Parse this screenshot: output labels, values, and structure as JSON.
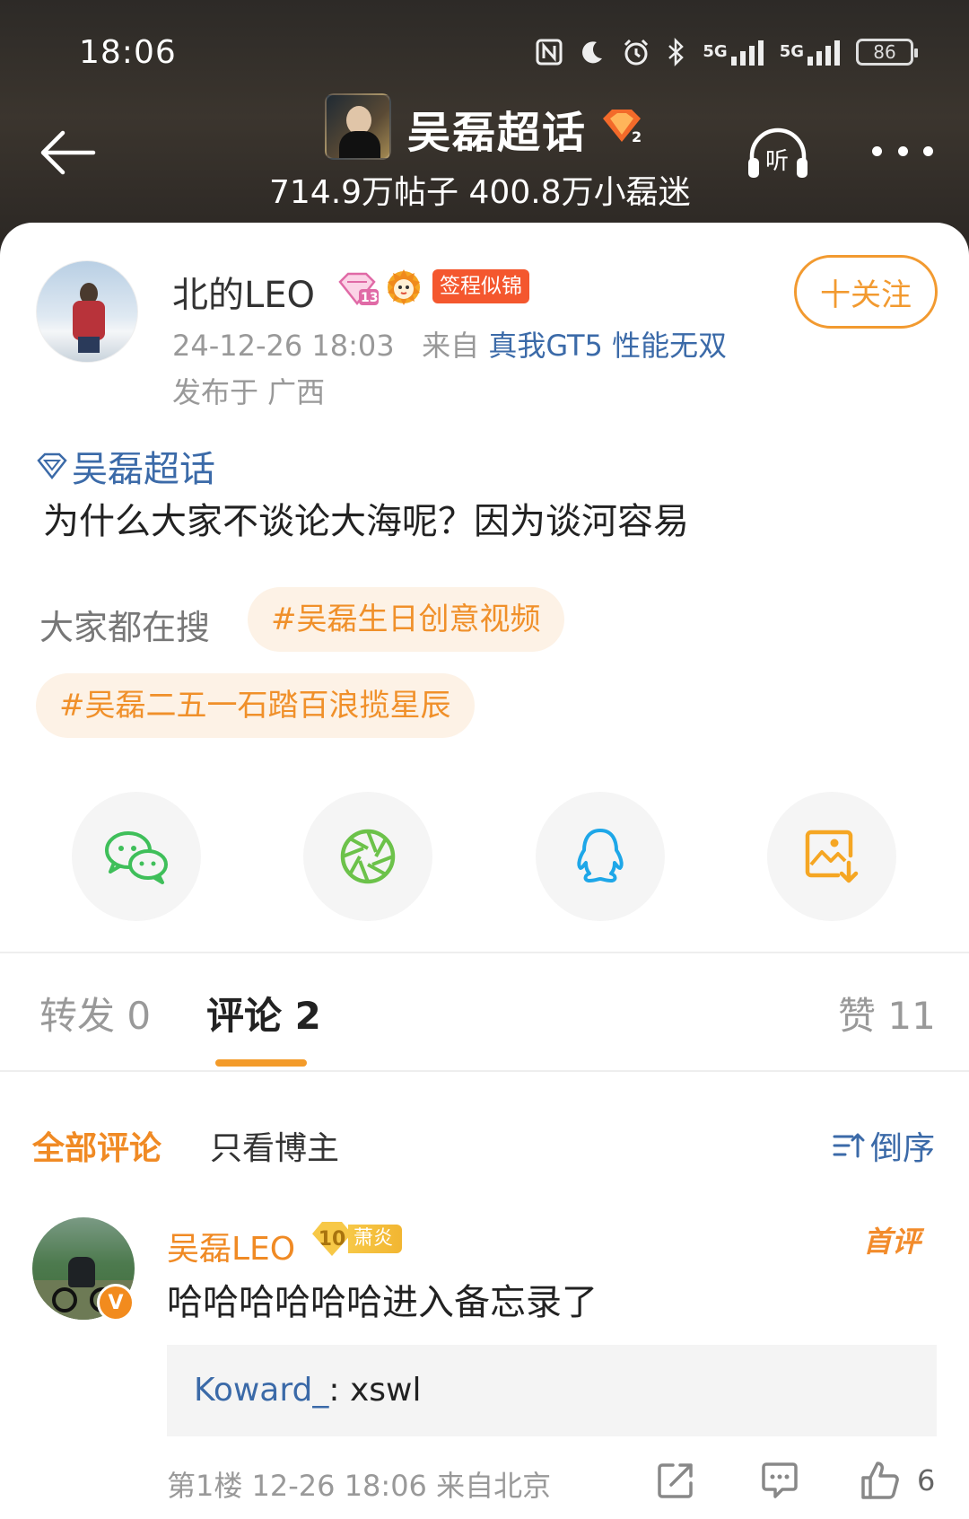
{
  "status": {
    "time": "18:06",
    "net1": "5G",
    "net2": "5G",
    "battery": "86"
  },
  "header": {
    "title": "吴磊超话",
    "title_badge_level": "2",
    "stats": "714.9万帖子 400.8万小磊迷",
    "listen_label": "听"
  },
  "post": {
    "author": "北的LEO",
    "level_badge": "13",
    "tag_badge": "签程似锦",
    "follow_label": "十关注",
    "time": "24-12-26 18:03",
    "from_prefix": "来自",
    "source": "真我GT5 性能无双",
    "location": "发布于 广西",
    "topic": "吴磊超话",
    "text": "为什么大家不谈论大海呢？因为谈河容易",
    "search_label": "大家都在搜",
    "hot_searches": [
      "#吴磊生日创意视频",
      "#吴磊二五一石踏百浪揽星辰"
    ]
  },
  "share_targets": [
    "wechat-icon",
    "moments-icon",
    "qq-icon",
    "save-image-icon"
  ],
  "tabs": {
    "repost": "转发 0",
    "comment": "评论 2",
    "like": "赞 11"
  },
  "filter": {
    "all": "全部评论",
    "host_only": "只看博主",
    "sort": "倒序"
  },
  "comment": {
    "user": "吴磊LEO",
    "verified": "V",
    "fan_level": "10",
    "fan_name": "萧炎",
    "first_tag": "首评",
    "text": "哈哈哈哈哈哈进入备忘录了",
    "reply_user": "Koward_",
    "reply_text": ": xswl",
    "meta": "第1楼 12-26 18:06 来自北京",
    "likes": "6"
  },
  "colors": {
    "accent": "#f08a24",
    "link": "#3b6aa8",
    "tag_red": "#f4572e"
  }
}
